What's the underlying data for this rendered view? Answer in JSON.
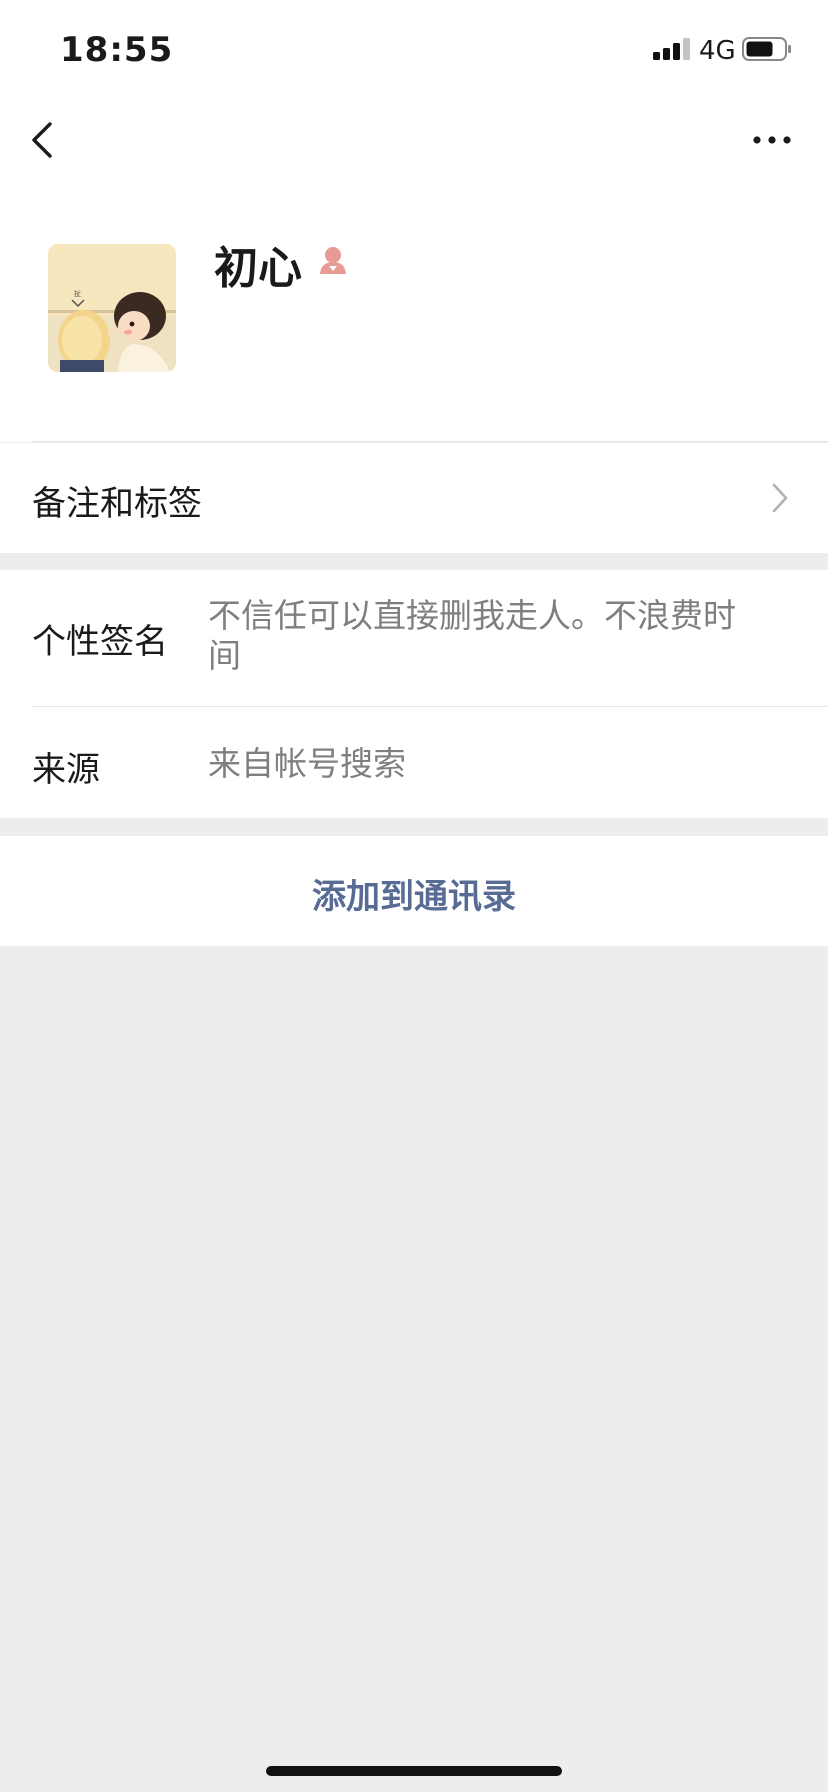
{
  "status_bar": {
    "time": "18:55",
    "network": "4G",
    "battery_icon": "battery-icon",
    "signal_icon": "signal-icon"
  },
  "nav": {
    "back_icon": "chevron-left-icon",
    "more_icon": "more-dots-icon"
  },
  "profile": {
    "name": "初心",
    "gender_icon": "female-icon",
    "gender_color": "#e89a96",
    "avatar": "avatar-image"
  },
  "remark": {
    "label": "备注和标签",
    "chevron_icon": "chevron-right-icon"
  },
  "info": {
    "signature_label": "个性签名",
    "signature_value": "不信任可以直接删我走人。不浪费时间",
    "source_label": "来源",
    "source_value": "来自帐号搜索"
  },
  "actions": {
    "add_contact_label": "添加到通讯录",
    "link_color": "#576b95"
  },
  "colors": {
    "page_bg": "#ededed",
    "card_bg": "#ffffff",
    "secondary_text": "#7f7f7f"
  }
}
